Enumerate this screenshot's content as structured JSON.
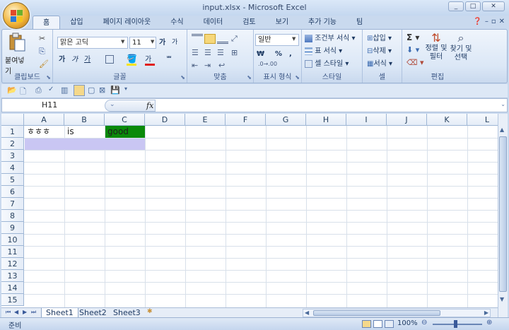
{
  "window": {
    "title": "input.xlsx - Microsoft Excel",
    "controls": [
      "_",
      "□",
      "✕"
    ]
  },
  "ribbon_tabs": [
    "홈",
    "삽입",
    "페이지 레이아웃",
    "수식",
    "데이터",
    "검토",
    "보기",
    "추가 기능",
    "팀"
  ],
  "active_tab": "홈",
  "clipboard": {
    "paste_label": "붙여넣기",
    "group_label": "클립보드"
  },
  "font": {
    "name": "맑은 고딕",
    "size": "11",
    "bold": "가",
    "italic": "가",
    "underline": "가",
    "grow": "가",
    "shrink": "가",
    "group_label": "글꼴"
  },
  "alignment": {
    "group_label": "맞춤"
  },
  "number": {
    "format": "일반",
    "currency": "₩",
    "percent": "%",
    "comma": ",",
    "group_label": "표시 형식"
  },
  "styles": {
    "conditional": "조건부 서식",
    "table_format": "표 서식",
    "cell_style": "셀 스타일",
    "group_label": "스타일"
  },
  "cells_group": {
    "insert": "삽입",
    "delete": "삭제",
    "format": "서식",
    "group_label": "셀"
  },
  "editing": {
    "sort_filter": "정렬 및\n필터",
    "find_select": "찾기 및\n선택",
    "group_label": "편집"
  },
  "formula_bar": {
    "name_box": "H11",
    "fx": "fx",
    "content": ""
  },
  "columns": [
    "A",
    "B",
    "C",
    "D",
    "E",
    "F",
    "G",
    "H",
    "I",
    "J",
    "K",
    "L"
  ],
  "rows": [
    "1",
    "2",
    "3",
    "4",
    "5",
    "6",
    "7",
    "8",
    "9",
    "10",
    "11",
    "12",
    "13",
    "14",
    "15"
  ],
  "cells": {
    "A1": "ㅎㅎㅎ",
    "B1": "is",
    "C1": "good"
  },
  "colors": {
    "C1_fill": "#0a8a0a",
    "row2_fill": "#c9c6f3"
  },
  "sheets": [
    "Sheet1",
    "Sheet2",
    "Sheet3"
  ],
  "active_sheet": "Sheet1",
  "status": {
    "mode": "준비",
    "zoom": "100%"
  }
}
